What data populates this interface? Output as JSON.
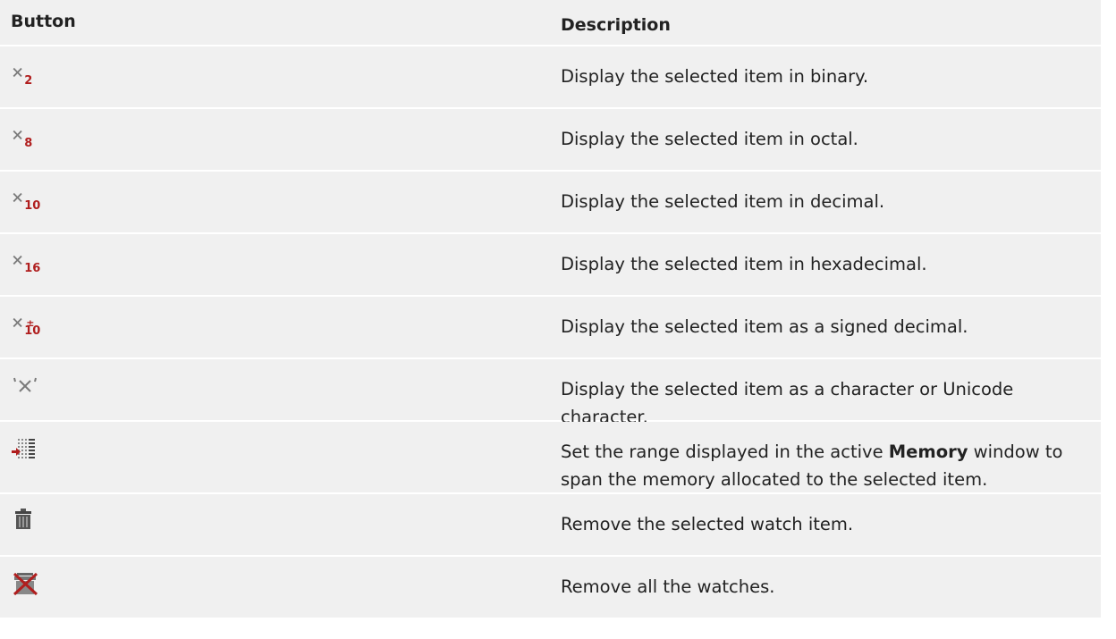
{
  "header": {
    "button": "Button",
    "description": "Description"
  },
  "rows": [
    {
      "icon": "binary-x2-icon",
      "sub": "2",
      "description": "Display the selected item in binary."
    },
    {
      "icon": "octal-x8-icon",
      "sub": "8",
      "description": "Display the selected item in octal."
    },
    {
      "icon": "decimal-x10-icon",
      "sub": "10",
      "description": "Display the selected item in decimal."
    },
    {
      "icon": "hex-x16-icon",
      "sub": "16",
      "description": "Display the selected item in hexadecimal."
    },
    {
      "icon": "signed-decimal-icon",
      "sub": "10",
      "description": "Display the selected item as a signed decimal."
    },
    {
      "icon": "character-icon",
      "description": "Display the selected item as a character or Unicode character."
    },
    {
      "icon": "memory-range-icon",
      "description_pre": "Set the range displayed in the active ",
      "description_bold": "Memory",
      "description_post": " window to span the memory allocated to the selected item."
    },
    {
      "icon": "trash-icon",
      "description": "Remove the selected watch item."
    },
    {
      "icon": "remove-all-watches-icon",
      "description": "Remove all the watches."
    }
  ],
  "colors": {
    "row_bg": "#f0f0f0",
    "icon_red": "#b01e1e",
    "icon_gray": "#7a7a7a"
  }
}
